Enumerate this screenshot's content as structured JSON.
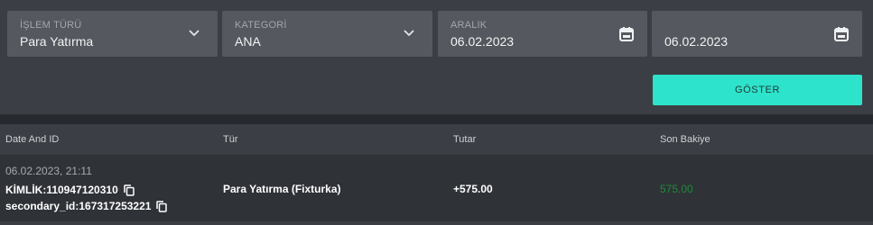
{
  "filters": {
    "islem_turu": {
      "label": "İŞLEM TÜRÜ",
      "value": "Para Yatırma",
      "icon": "chevron-down-icon"
    },
    "kategori": {
      "label": "KATEGORİ",
      "value": "ANA",
      "icon": "chevron-down-icon"
    },
    "aralik_start": {
      "label": "ARALIK",
      "value": "06.02.2023",
      "icon": "calendar-icon"
    },
    "aralik_end": {
      "value": "06.02.2023",
      "icon": "calendar-icon"
    },
    "show_button": "GÖSTER"
  },
  "table": {
    "headers": [
      "Date And ID",
      "Tür",
      "Tutar",
      "Son Bakiye"
    ],
    "rows": [
      {
        "date": "06.02.2023, 21:11",
        "kimlik": "KİMLİK:110947120310",
        "secondary_id": "secondary_id:167317253221",
        "tur": "Para Yatırma (Fixturka)",
        "tutar": "+575.00",
        "son_bakiye": "575.00"
      }
    ]
  },
  "colors": {
    "accent": "#2ee3cb",
    "balance_green": "#1f8a3a",
    "panel": "#3b3e44",
    "field": "#55585e"
  }
}
